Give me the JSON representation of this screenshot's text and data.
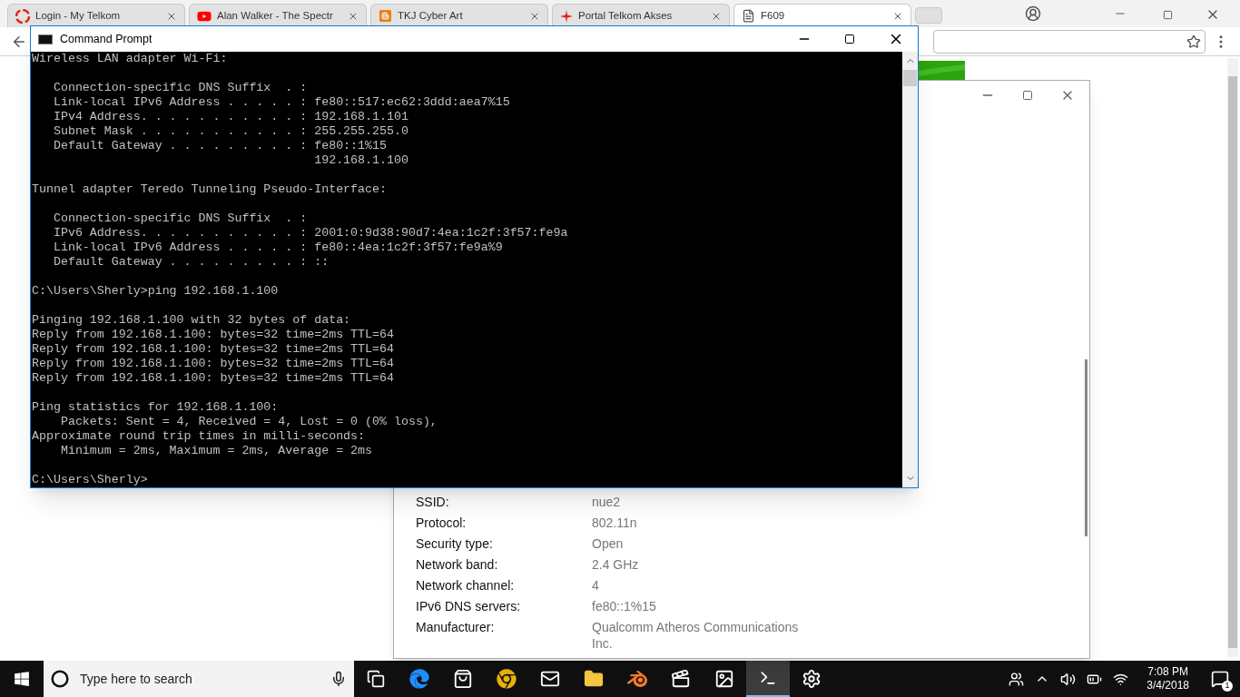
{
  "browser": {
    "tabs": [
      {
        "title": "Login - My Telkom",
        "kind": "telkom",
        "selected": false
      },
      {
        "title": "Alan Walker - The Spectr",
        "kind": "youtube",
        "selected": false
      },
      {
        "title": "TKJ Cyber Art",
        "kind": "blogger",
        "selected": false
      },
      {
        "title": "Portal Telkom Akses",
        "kind": "spark",
        "selected": false
      },
      {
        "title": "F609",
        "kind": "page",
        "selected": true
      }
    ]
  },
  "properties_window": {
    "rows": [
      {
        "label": "SSID:",
        "value": "nue2"
      },
      {
        "label": "Protocol:",
        "value": "802.11n"
      },
      {
        "label": "Security type:",
        "value": "Open"
      },
      {
        "label": "Network band:",
        "value": "2.4 GHz"
      },
      {
        "label": "Network channel:",
        "value": "4"
      },
      {
        "label": "IPv6 DNS servers:",
        "value": "fe80::1%15"
      },
      {
        "label": "Manufacturer:",
        "value": "Qualcomm Atheros Communications Inc."
      }
    ]
  },
  "command_prompt": {
    "title": "Command Prompt",
    "blocks": [
      [
        "Wireless LAN adapter Wi-Fi:"
      ],
      [
        "   Connection-specific DNS Suffix  . :",
        "   Link-local IPv6 Address . . . . . : fe80::517:ec62:3ddd:aea7%15",
        "   IPv4 Address. . . . . . . . . . . : 192.168.1.101",
        "   Subnet Mask . . . . . . . . . . . : 255.255.255.0",
        "   Default Gateway . . . . . . . . . : fe80::1%15",
        "                                       192.168.1.100"
      ],
      [
        "Tunnel adapter Teredo Tunneling Pseudo-Interface:"
      ],
      [
        "   Connection-specific DNS Suffix  . :",
        "   IPv6 Address. . . . . . . . . . . : 2001:0:9d38:90d7:4ea:1c2f:3f57:fe9a",
        "   Link-local IPv6 Address . . . . . : fe80::4ea:1c2f:3f57:fe9a%9",
        "   Default Gateway . . . . . . . . . : ::"
      ],
      [
        "C:\\Users\\Sherly>ping 192.168.1.100"
      ],
      [
        "Pinging 192.168.1.100 with 32 bytes of data:",
        "Reply from 192.168.1.100: bytes=32 time=2ms TTL=64",
        "Reply from 192.168.1.100: bytes=32 time=2ms TTL=64",
        "Reply from 192.168.1.100: bytes=32 time=2ms TTL=64",
        "Reply from 192.168.1.100: bytes=32 time=2ms TTL=64"
      ],
      [
        "Ping statistics for 192.168.1.100:",
        "    Packets: Sent = 4, Received = 4, Lost = 0 (0% loss),",
        "Approximate round trip times in milli-seconds:",
        "    Minimum = 2ms, Maximum = 2ms, Average = 2ms"
      ],
      [
        "C:\\Users\\Sherly>"
      ]
    ]
  },
  "taskbar": {
    "search": {
      "placeholder": "Type here to search"
    },
    "apps": [
      {
        "kind": "taskview",
        "selected": false
      },
      {
        "kind": "edge",
        "selected": false
      },
      {
        "kind": "store",
        "selected": false
      },
      {
        "kind": "chrome",
        "selected": false
      },
      {
        "kind": "mail",
        "selected": false
      },
      {
        "kind": "explorer",
        "selected": false
      },
      {
        "kind": "blender",
        "selected": false
      },
      {
        "kind": "video",
        "selected": false
      },
      {
        "kind": "photos",
        "selected": false
      },
      {
        "kind": "cmd",
        "selected": true
      },
      {
        "kind": "settings",
        "selected": false
      }
    ],
    "time": "7:08 PM",
    "date": "3/4/2018",
    "notifications": "1"
  }
}
